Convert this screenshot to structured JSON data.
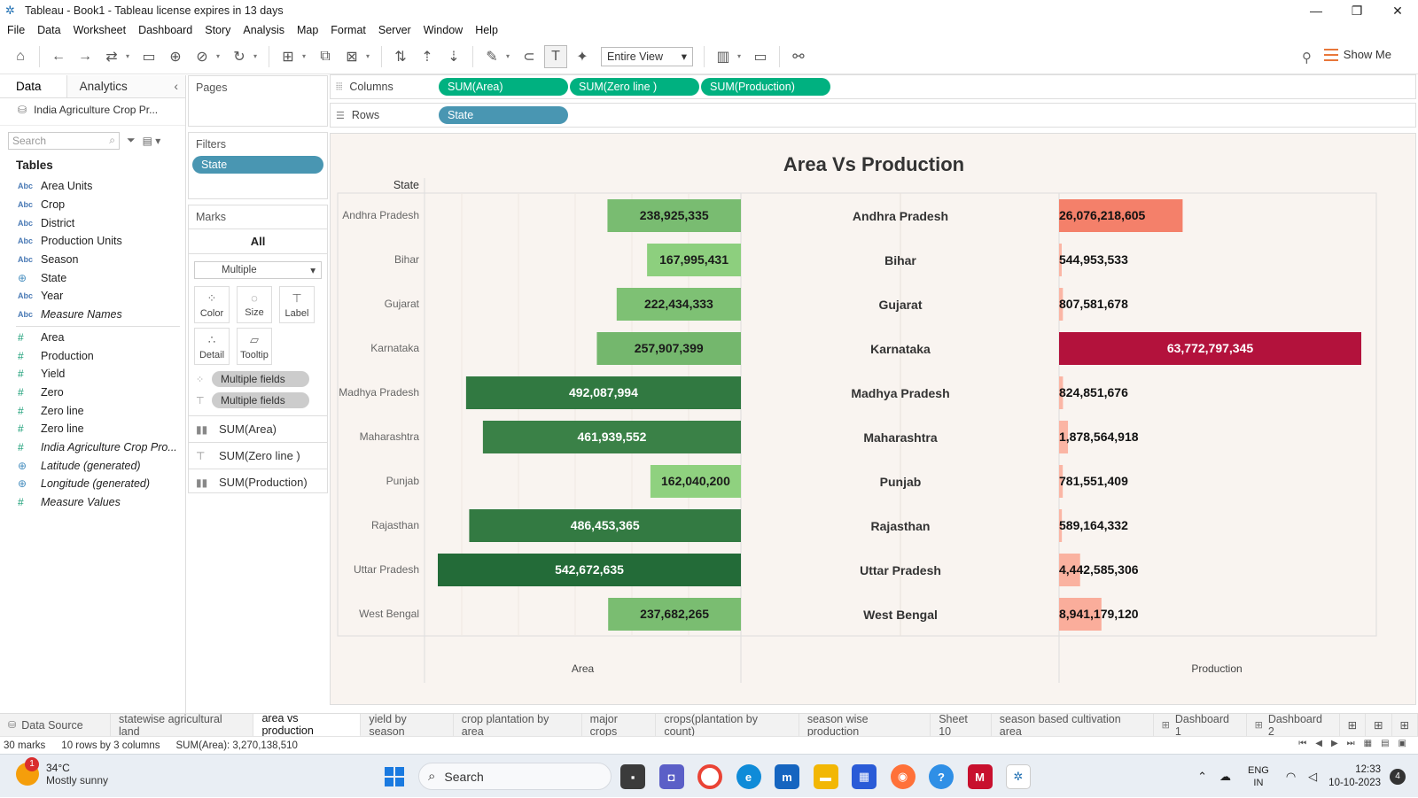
{
  "window": {
    "title": "Tableau - Book1 - Tableau license expires in 13 days",
    "controls": {
      "minimize": "—",
      "maximize": "❐",
      "close": "✕"
    }
  },
  "menu": [
    "File",
    "Data",
    "Worksheet",
    "Dashboard",
    "Story",
    "Analysis",
    "Map",
    "Format",
    "Server",
    "Window",
    "Help"
  ],
  "toolbar": {
    "fit": "Entire View",
    "show_me": "Show Me"
  },
  "data_pane": {
    "tabs": {
      "data": "Data",
      "analytics": "Analytics"
    },
    "datasource": "India Agriculture Crop Pr...",
    "search_placeholder": "Search",
    "tables_header": "Tables",
    "dimensions": [
      {
        "type": "Abc",
        "name": "Area Units"
      },
      {
        "type": "Abc",
        "name": "Crop"
      },
      {
        "type": "Abc",
        "name": "District"
      },
      {
        "type": "Abc",
        "name": "Production Units"
      },
      {
        "type": "Abc",
        "name": "Season"
      },
      {
        "type": "geo",
        "name": "State"
      },
      {
        "type": "Abc",
        "name": "Year"
      },
      {
        "type": "Abc",
        "name": "Measure Names",
        "italic": true
      }
    ],
    "measures": [
      {
        "type": "#",
        "name": "Area"
      },
      {
        "type": "#",
        "name": "Production"
      },
      {
        "type": "#",
        "name": "Yield"
      },
      {
        "type": "#",
        "name": "Zero"
      },
      {
        "type": "#",
        "name": "Zero line"
      },
      {
        "type": "#",
        "name": "Zero line"
      },
      {
        "type": "#",
        "name": "India Agriculture Crop Pro...",
        "italic": true
      },
      {
        "type": "geo",
        "name": "Latitude (generated)",
        "italic": true
      },
      {
        "type": "geo",
        "name": "Longitude (generated)",
        "italic": true
      },
      {
        "type": "#",
        "name": "Measure Values",
        "italic": true
      }
    ]
  },
  "cards": {
    "pages": "Pages",
    "filters": "Filters",
    "filter_pill": "State",
    "marks": "Marks",
    "marks_all": "All",
    "mark_type": "Multiple",
    "buttons": {
      "color": "Color",
      "size": "Size",
      "label": "Label",
      "detail": "Detail",
      "tooltip": "Tooltip"
    },
    "mark_fields": [
      "Multiple fields",
      "Multiple fields"
    ],
    "mark_pills": [
      "SUM(Area)",
      "SUM(Zero line )",
      "SUM(Production)"
    ]
  },
  "shelves": {
    "columns_label": "Columns",
    "rows_label": "Rows",
    "columns": [
      "SUM(Area)",
      "SUM(Zero line )",
      "SUM(Production)"
    ],
    "rows": [
      "State"
    ]
  },
  "chart_data": {
    "type": "bar",
    "title": "Area Vs Production",
    "row_header": "State",
    "categories": [
      "Andhra Pradesh",
      "Bihar",
      "Gujarat",
      "Karnataka",
      "Madhya Pradesh",
      "Maharashtra",
      "Punjab",
      "Rajasthan",
      "Uttar Pradesh",
      "West Bengal"
    ],
    "series": [
      {
        "name": "Area",
        "values": [
          238925335,
          167995431,
          222434333,
          257907399,
          492087994,
          461939552,
          162040200,
          486453365,
          542672635,
          237682265
        ],
        "direction": "left"
      },
      {
        "name": "Production",
        "values": [
          26076218605,
          544953533,
          807581678,
          63772797345,
          824851676,
          1878564918,
          781551409,
          589164332,
          4442585306,
          8941179120
        ],
        "direction": "right"
      }
    ],
    "labels_area": [
      "238,925,335",
      "167,995,431",
      "222,434,333",
      "257,907,399",
      "492,087,994",
      "461,939,552",
      "162,040,200",
      "486,453,365",
      "542,672,635",
      "237,682,265"
    ],
    "labels_production": [
      "26,076,218,605",
      "544,953,533",
      "807,581,678",
      "63,772,797,345",
      "824,851,676",
      "1,878,564,918",
      "781,551,409",
      "589,164,332",
      "4,442,585,306",
      "8,941,179,120"
    ],
    "xlabel_area": "Area",
    "xlabel_production": "Production",
    "area_colors": {
      "light": "#8fd17f",
      "dark": "#236b38"
    },
    "production_colors": {
      "light": "#fbb7a6",
      "mid": "#f4806a",
      "dark": "#b3123c"
    },
    "grid": false
  },
  "sheet_tabs": [
    {
      "label": "Data Source",
      "icon": "datasource-icon"
    },
    {
      "label": "statewise agricultural land"
    },
    {
      "label": "area vs production",
      "active": true
    },
    {
      "label": "yield by season"
    },
    {
      "label": "crop plantation by area"
    },
    {
      "label": "major crops"
    },
    {
      "label": "crops(plantation by count)"
    },
    {
      "label": "season wise production"
    },
    {
      "label": "Sheet 10"
    },
    {
      "label": "season based cultivation area"
    },
    {
      "label": "Dashboard 1",
      "icon": "dashboard-icon"
    },
    {
      "label": "Dashboard 2",
      "icon": "dashboard-icon"
    }
  ],
  "status": {
    "marks": "30 marks",
    "dims": "10 rows by 3 columns",
    "sum": "SUM(Area): 3,270,138,510"
  },
  "taskbar": {
    "temp": "34°C",
    "weather": "Mostly sunny",
    "weather_badge": "1",
    "search": "Search",
    "lang1": "ENG",
    "lang2": "IN",
    "time": "12:33",
    "date": "10-10-2023",
    "notifications": "4"
  }
}
